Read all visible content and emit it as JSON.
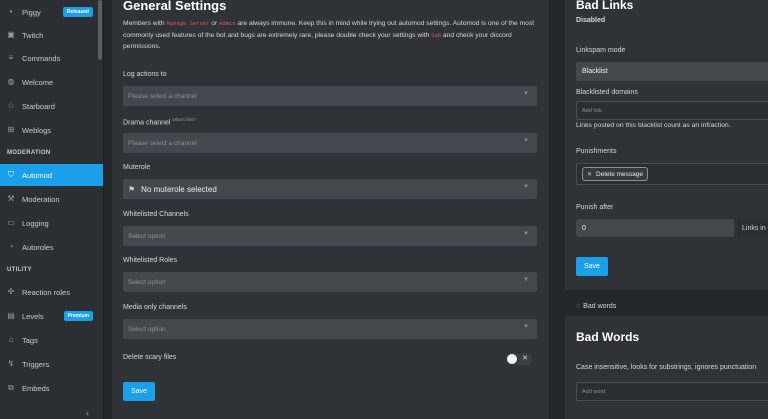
{
  "sidebar": {
    "items": [
      {
        "label": "Piggy",
        "badge": "Released",
        "icon": "pig-icon"
      },
      {
        "label": "Twitch",
        "icon": "twitch-icon"
      },
      {
        "label": "Commands",
        "icon": "commands-icon"
      },
      {
        "label": "Welcome",
        "icon": "welcome-icon"
      },
      {
        "label": "Starboard",
        "icon": "star-icon"
      },
      {
        "label": "Weblogs",
        "icon": "weblogs-icon"
      },
      {
        "label": "Automod",
        "icon": "shield-icon",
        "active": true
      },
      {
        "label": "Moderation",
        "icon": "hammer-icon"
      },
      {
        "label": "Logging",
        "icon": "logging-icon"
      },
      {
        "label": "Autoroles",
        "icon": "autoroles-icon"
      },
      {
        "label": "Reaction roles",
        "icon": "reaction-icon"
      },
      {
        "label": "Levels",
        "badge": "Premium",
        "icon": "levels-icon"
      },
      {
        "label": "Tags",
        "icon": "tag-icon"
      },
      {
        "label": "Triggers",
        "icon": "triggers-icon"
      },
      {
        "label": "Embeds",
        "icon": "embeds-icon"
      }
    ],
    "sections": {
      "moderation": "MODERATION",
      "utility": "UTILITY"
    },
    "collapse_icon": "chevron-left-icon"
  },
  "general": {
    "title": "General Settings",
    "desc": {
      "p1": "Members with ",
      "code1": "Manage Server",
      "p2": " or ",
      "code2": "Admin",
      "p3": " are always immune. Keep this in mind while trying out automod settings. Automod is one of the most commonly used features of the bot and bugs are extremely rare, please double check your settings with ",
      "code3": "Sub",
      "p4": " and check your discord permissions."
    },
    "log_actions": {
      "label": "Log actions to",
      "placeholder": "Please select a channel"
    },
    "drama": {
      "label": "Drama channel",
      "hint": "what's this?",
      "placeholder": "Please select a channel"
    },
    "muterole": {
      "label": "Muterole",
      "value": "No muterole selected"
    },
    "whitelisted_channels": {
      "label": "Whitelisted Channels",
      "placeholder": "Select option"
    },
    "whitelisted_roles": {
      "label": "Whitelisted Roles",
      "placeholder": "Select option"
    },
    "media_only": {
      "label": "Media only channels",
      "placeholder": "Select option"
    },
    "delete_scary": {
      "label": "Delete scary files",
      "enabled": false
    },
    "save_label": "Save"
  },
  "bad_links": {
    "title": "Bad Links",
    "status": "Disabled",
    "linkspam_label": "Linkspam mode",
    "linkspam_value": "Blacklist",
    "blacklisted_label": "Blacklisted domains",
    "add_link_placeholder": "Add link",
    "blacklist_note": "Links posted on this blacklist count as an infraction.",
    "punishments_label": "Punishments",
    "punishment_chip": "Delete message",
    "punish_after_label": "Punish after",
    "punish_after_value": "0",
    "links_in": "Links in",
    "save_label": "Save"
  },
  "bad_words_bar": {
    "label": "Bad words"
  },
  "bad_words": {
    "title": "Bad Words",
    "note": "Case insensitive, looks for substrings, ignores punctuation",
    "add_word_placeholder": "Add word"
  },
  "colors": {
    "accent": "#1a9fe8",
    "code": "#e5547a"
  }
}
